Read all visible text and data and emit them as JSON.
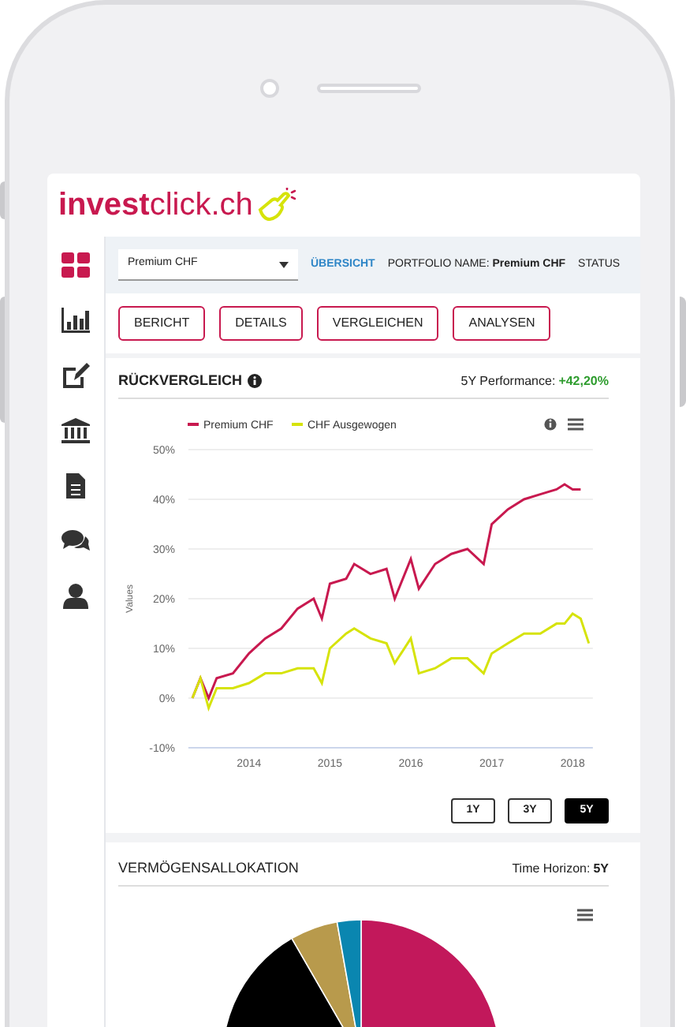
{
  "logo": {
    "text": "**invest**click.ch"
  },
  "sidebar": {
    "items": [
      {
        "selected": true
      },
      {
        "selected": false
      },
      {
        "selected": false
      },
      {
        "selected": false
      },
      {
        "selected": false
      },
      {
        "selected": false
      },
      {
        "selected": false
      }
    ]
  },
  "top_bar": {
    "portfolio_select": {
      "value": "Premium CHF"
    },
    "overview_link": "ÜBERSICHT",
    "portfolio_name": "PORTFOLIO NAME: **Premium CHF**",
    "status_label": "STATUS"
  },
  "report_buttons": [
    "BERICHT",
    "DETAILS",
    "VERGLEICHEN",
    "ANALYSEN"
  ],
  "backtest": {
    "title": "RÜCKVERGLEICH",
    "performance_label": "5Y Performance:",
    "performance_value": "+42,20%",
    "chart_data": {
      "type": "line",
      "ylabel": "Values",
      "grid": true,
      "legend": true,
      "x": [
        2013.3,
        2013.4,
        2013.5,
        2013.6,
        2013.8,
        2014.0,
        2014.2,
        2014.4,
        2014.6,
        2014.8,
        2014.9,
        2015.0,
        2015.2,
        2015.3,
        2015.5,
        2015.7,
        2015.8,
        2016.0,
        2016.1,
        2016.3,
        2016.5,
        2016.7,
        2016.9,
        2017.0,
        2017.2,
        2017.4,
        2017.6,
        2017.8,
        2017.9,
        2018.0,
        2018.1,
        2018.2
      ],
      "series": [
        {
          "name": "Premium CHF",
          "color": "#c8194f",
          "values": [
            0,
            4,
            0,
            4,
            5,
            9,
            12,
            14,
            18,
            20,
            16,
            23,
            24,
            27,
            25,
            26,
            20,
            28,
            22,
            27,
            29,
            30,
            27,
            35,
            38,
            40,
            41,
            42,
            43,
            42,
            42,
            null
          ]
        },
        {
          "name": "CHF Ausgewogen",
          "color": "#d6e30a",
          "values": [
            0,
            4,
            -2,
            2,
            2,
            3,
            5,
            5,
            6,
            6,
            3,
            10,
            13,
            14,
            12,
            11,
            7,
            12,
            5,
            6,
            8,
            8,
            5,
            9,
            11,
            13,
            13,
            15,
            15,
            17,
            16,
            11
          ]
        }
      ],
      "xlim": [
        2013.25,
        2018.25
      ],
      "ylim": [
        -10,
        50
      ],
      "xticks": [
        2014,
        2015,
        2016,
        2017,
        2018
      ],
      "yticks": [
        {
          "value": -10,
          "label": "-10%"
        },
        {
          "value": 0,
          "label": "0%"
        },
        {
          "value": 10,
          "label": "10%"
        },
        {
          "value": 20,
          "label": "20%"
        },
        {
          "value": 30,
          "label": "30%"
        },
        {
          "value": 40,
          "label": "40%"
        },
        {
          "value": 50,
          "label": "50%"
        }
      ]
    },
    "ranges": [
      {
        "label": "1Y",
        "selected": false
      },
      {
        "label": "3Y",
        "selected": false
      },
      {
        "label": "5Y",
        "selected": true
      }
    ]
  },
  "allocation": {
    "title": "VERMÖGENSALLOKATION",
    "horizon_label": "Time Horizon:",
    "horizon_value": "5Y"
  }
}
